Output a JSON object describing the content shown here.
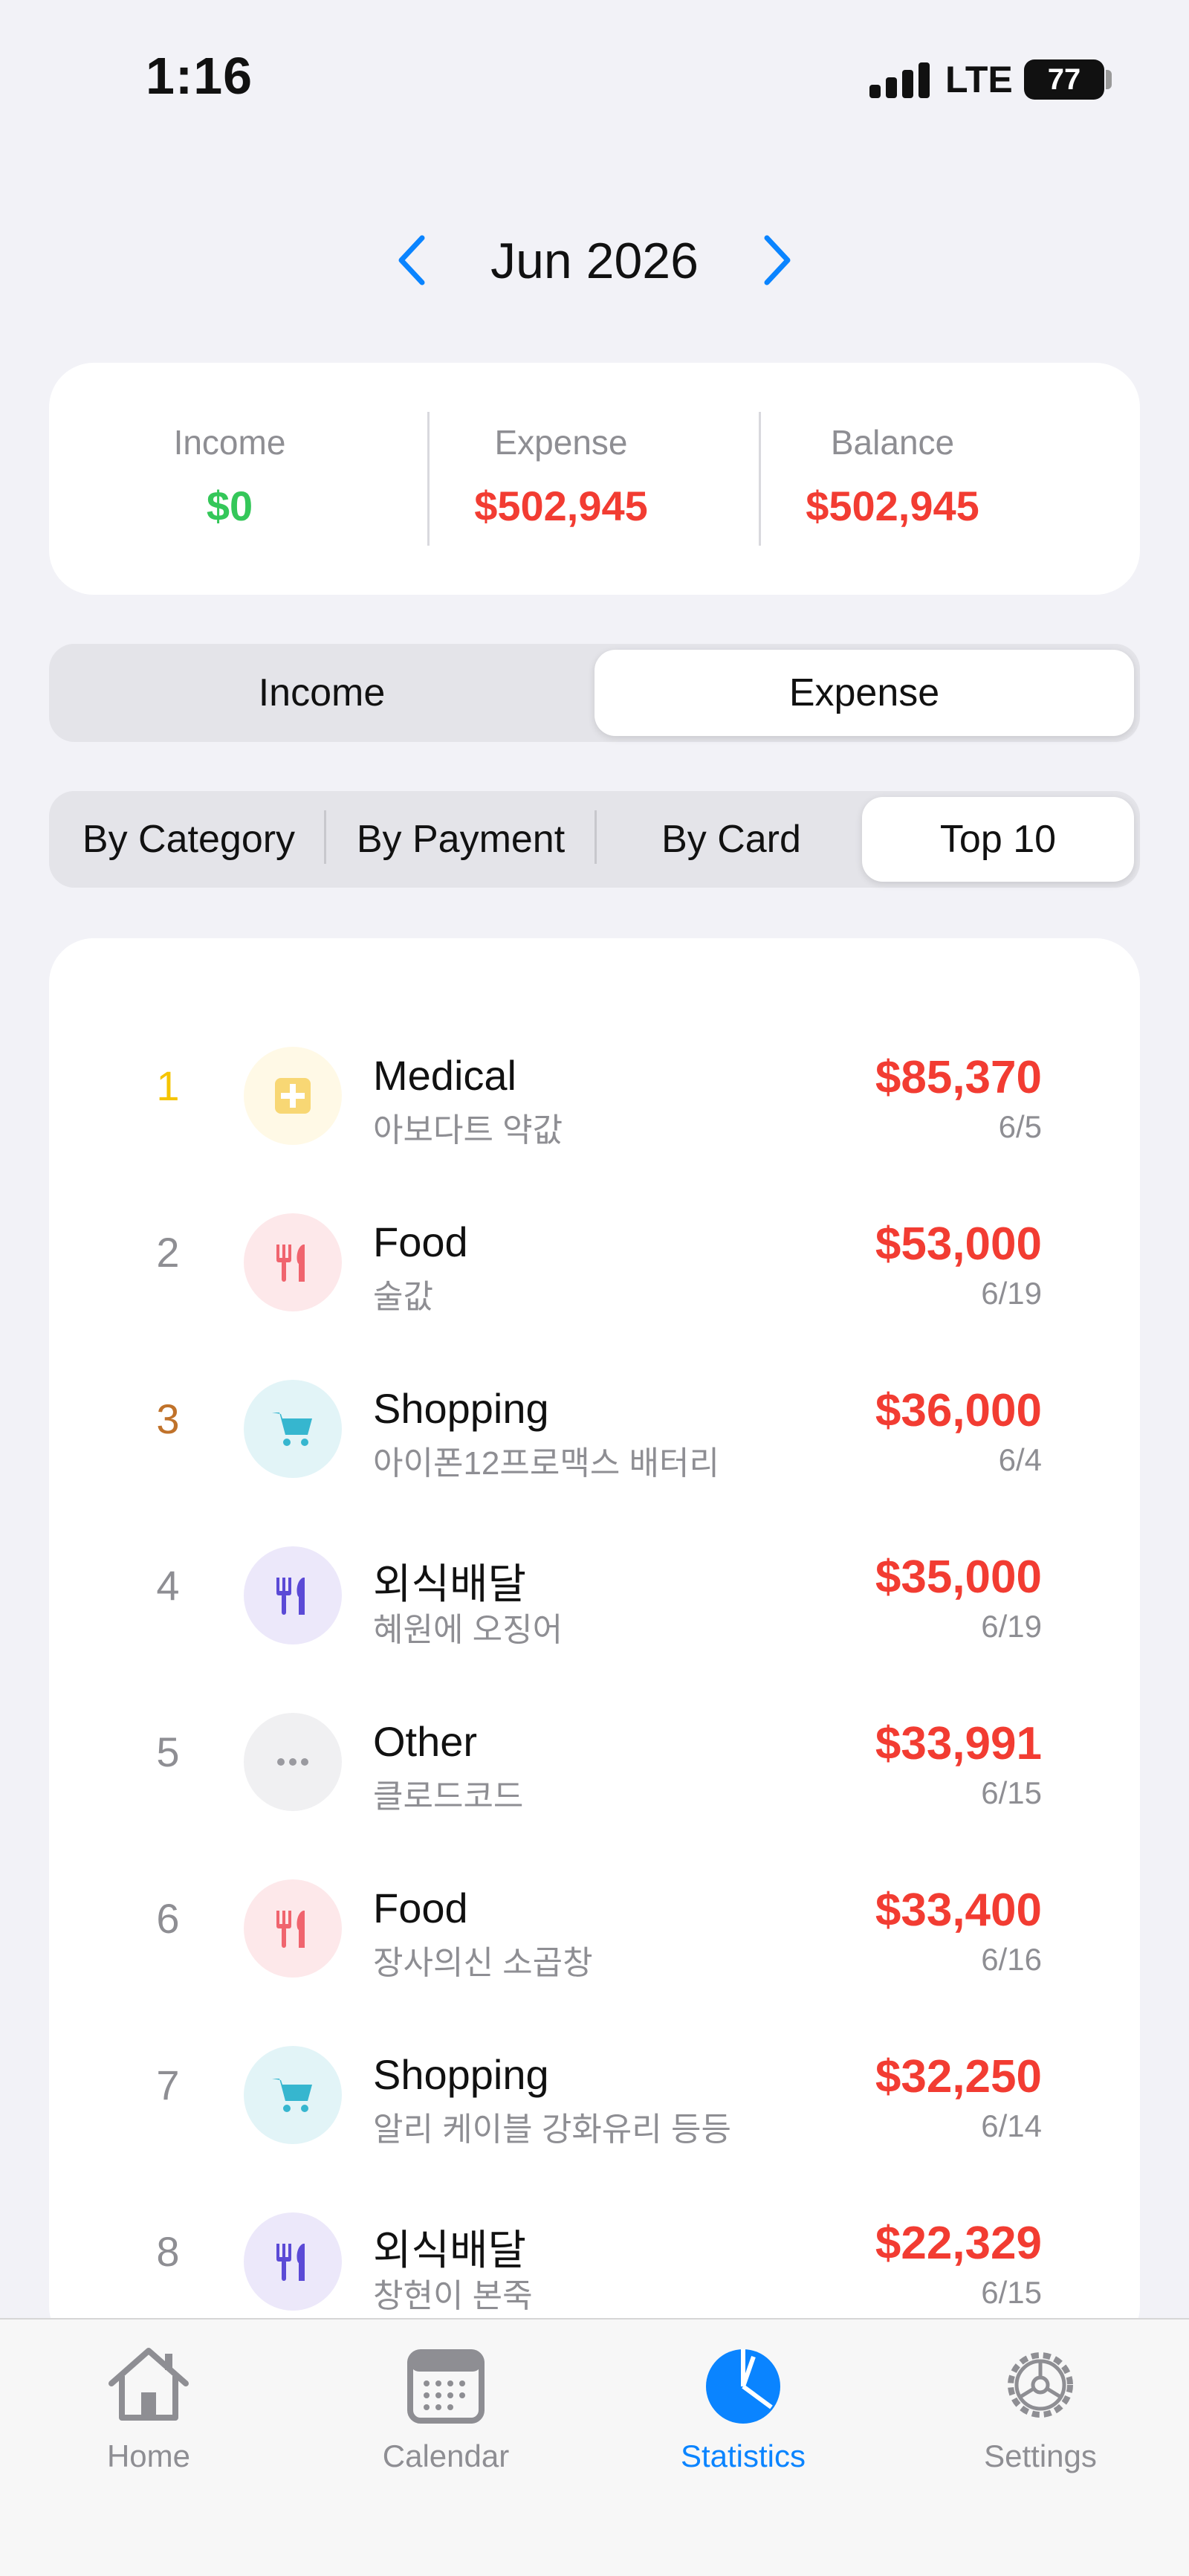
{
  "status_bar": {
    "time": "1:16",
    "network": "LTE",
    "battery": "77"
  },
  "month_nav": {
    "title": "Jun 2026",
    "prev_icon": "chevron-left-icon",
    "next_icon": "chevron-right-icon",
    "accent": "#0a84ff"
  },
  "summary": {
    "income_label": "Income",
    "income_value": "$0",
    "income_color": "#34c759",
    "expense_label": "Expense",
    "expense_value": "$502,945",
    "expense_color": "#f23c32",
    "balance_label": "Balance",
    "balance_value": "$502,945",
    "balance_color": "#f23c32"
  },
  "type_toggle": {
    "options": [
      "Income",
      "Expense"
    ],
    "selected": "Expense"
  },
  "view_toggle": {
    "options": [
      "By Category",
      "By Payment",
      "By Card",
      "Top 10"
    ],
    "selected": "Top 10"
  },
  "top_list": [
    {
      "rank": "1",
      "rank_color": "#f5c400",
      "category": "Medical",
      "icon": "medical-cross-icon",
      "icon_bg": "#fff9e6",
      "icon_color": "#f8d774",
      "memo": "아보다트 약값",
      "amount": "$85,370",
      "date": "6/5"
    },
    {
      "rank": "2",
      "rank_color": "#8e8e93",
      "category": "Food",
      "icon": "fork-knife-icon",
      "icon_bg": "#fde8ea",
      "icon_color": "#f0646e",
      "memo": "술값",
      "amount": "$53,000",
      "date": "6/19"
    },
    {
      "rank": "3",
      "rank_color": "#c0722a",
      "category": "Shopping",
      "icon": "cart-icon",
      "icon_bg": "#e2f4f7",
      "icon_color": "#36b6cf",
      "memo": "아이폰12프로맥스 배터리",
      "amount": "$36,000",
      "date": "6/4"
    },
    {
      "rank": "4",
      "rank_color": "#8e8e93",
      "category": "외식배달",
      "icon": "fork-knife-icon",
      "icon_bg": "#ece8fa",
      "icon_color": "#5b4ad6",
      "memo": "혜원에 오징어",
      "amount": "$35,000",
      "date": "6/19"
    },
    {
      "rank": "5",
      "rank_color": "#8e8e93",
      "category": "Other",
      "icon": "ellipsis-icon",
      "icon_bg": "#f0f0f2",
      "icon_color": "#9a9aa0",
      "memo": "클로드코드",
      "amount": "$33,991",
      "date": "6/15"
    },
    {
      "rank": "6",
      "rank_color": "#8e8e93",
      "category": "Food",
      "icon": "fork-knife-icon",
      "icon_bg": "#fde8ea",
      "icon_color": "#f0646e",
      "memo": "장사의신 소곱창",
      "amount": "$33,400",
      "date": "6/16"
    },
    {
      "rank": "7",
      "rank_color": "#8e8e93",
      "category": "Shopping",
      "icon": "cart-icon",
      "icon_bg": "#e2f4f7",
      "icon_color": "#36b6cf",
      "memo": "알리 케이블 강화유리 등등",
      "amount": "$32,250",
      "date": "6/14"
    },
    {
      "rank": "8",
      "rank_color": "#8e8e93",
      "category": "외식배달",
      "icon": "fork-knife-icon",
      "icon_bg": "#ece8fa",
      "icon_color": "#5b4ad6",
      "memo": "창현이 본죽",
      "amount": "$22,329",
      "date": "6/15"
    }
  ],
  "tab_bar": {
    "tabs": [
      {
        "label": "Home",
        "icon": "house-icon"
      },
      {
        "label": "Calendar",
        "icon": "calendar-icon"
      },
      {
        "label": "Statistics",
        "icon": "pie-chart-icon"
      },
      {
        "label": "Settings",
        "icon": "gear-icon"
      }
    ],
    "selected": "Statistics"
  }
}
